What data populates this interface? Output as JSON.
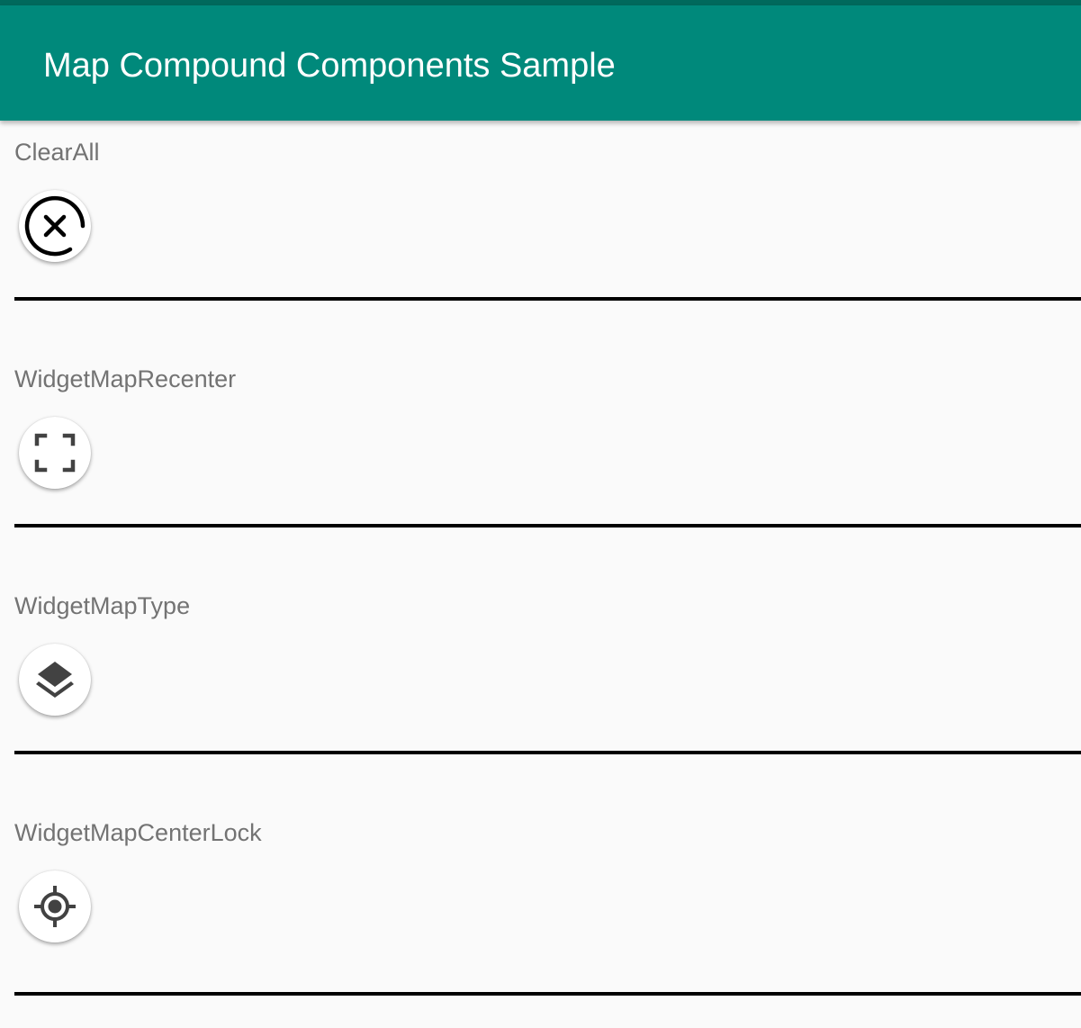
{
  "app_bar": {
    "title": "Map Compound Components Sample"
  },
  "sections": [
    {
      "label": "ClearAll",
      "icon": "clear-all-icon"
    },
    {
      "label": "WidgetMapRecenter",
      "icon": "recenter-icon"
    },
    {
      "label": "WidgetMapType",
      "icon": "layers-icon"
    },
    {
      "label": "WidgetMapCenterLock",
      "icon": "gps-fixed-icon"
    }
  ],
  "colors": {
    "app_bar": "#00897b",
    "status_bar": "#00695c",
    "background": "#fafafa",
    "label_text": "#737373",
    "icon_dark": "#424242"
  }
}
